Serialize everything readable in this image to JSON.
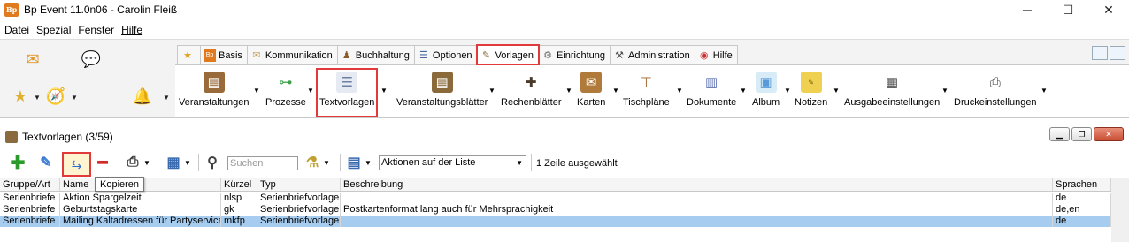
{
  "window": {
    "title": "Bp Event 11.0n06 - Carolin Fleiß",
    "app_icon_text": "Bp",
    "controls": [
      "─",
      "☐",
      "✕"
    ]
  },
  "menu": [
    "Datei",
    "Spezial",
    "Fenster",
    "Hilfe"
  ],
  "tabs": [
    {
      "label": "Basis",
      "icon": "bp-logo-icon"
    },
    {
      "label": "Kommunikation",
      "icon": "envelope-icon"
    },
    {
      "label": "Buchhaltung",
      "icon": "accountant-icon"
    },
    {
      "label": "Optionen",
      "icon": "options-icon"
    },
    {
      "label": "Vorlagen",
      "icon": "template-icon",
      "active": true
    },
    {
      "label": "Einrichtung",
      "icon": "gear-icon"
    },
    {
      "label": "Administration",
      "icon": "tools-icon"
    },
    {
      "label": "Hilfe",
      "icon": "lifebuoy-icon"
    }
  ],
  "ribbon_buttons": [
    {
      "label": "Veranstaltungen",
      "icon": "event-icon",
      "color": "#9a6b3a"
    },
    {
      "label": "Prozesse",
      "icon": "process-icon",
      "color": "#3aa14a"
    },
    {
      "label": "Textvorlagen",
      "icon": "text-template-icon",
      "color": "#6d7fa0",
      "highlighted": true
    },
    {
      "label": "Veranstaltungsblätter",
      "icon": "event-sheet-icon",
      "color": "#8a6a3a"
    },
    {
      "label": "Rechenblätter",
      "icon": "calc-sheet-icon",
      "color": "#4a3a2a"
    },
    {
      "label": "Karten",
      "icon": "card-icon",
      "color": "#b07a3a"
    },
    {
      "label": "Tischpläne",
      "icon": "table-plan-icon",
      "color": "#a0622a"
    },
    {
      "label": "Dokumente",
      "icon": "documents-icon",
      "color": "#5a6fb0"
    },
    {
      "label": "Album",
      "icon": "album-icon",
      "color": "#5a9ad8"
    },
    {
      "label": "Notizen",
      "icon": "notes-icon",
      "color": "#f0d050"
    },
    {
      "label": "Ausgabeeinstellungen",
      "icon": "output-settings-icon",
      "color": "#505050"
    },
    {
      "label": "Druckeinstellungen",
      "icon": "printer-icon",
      "color": "#404040"
    }
  ],
  "subwindow": {
    "title": "Textvorlagen (3/59)",
    "search_placeholder": "Suchen",
    "action_select": "Aktionen auf der Liste",
    "status": "1 Zeile ausgewählt",
    "tooltip": "Kopieren"
  },
  "table": {
    "columns": [
      "Gruppe/Art",
      "Name",
      "Kürzel",
      "Typ",
      "Beschreibung",
      "Sprachen"
    ],
    "rows": [
      [
        "Serienbriefe",
        "Aktion Spargelzeit",
        "nlsp",
        "Serienbriefvorlage",
        "",
        "de"
      ],
      [
        "Serienbriefe",
        "Geburtstagskarte",
        "gk",
        "Serienbriefvorlage",
        "Postkartenformat lang auch für Mehrsprachigkeit",
        "de,en"
      ],
      [
        "Serienbriefe",
        "Mailing Kaltadressen für Partyservice",
        "mkfp",
        "Serienbriefvorlage",
        "",
        "de"
      ]
    ],
    "selected_row": 2
  },
  "colors": {
    "highlight": "#e03a3a",
    "selected_row": "#a6cdf0"
  }
}
